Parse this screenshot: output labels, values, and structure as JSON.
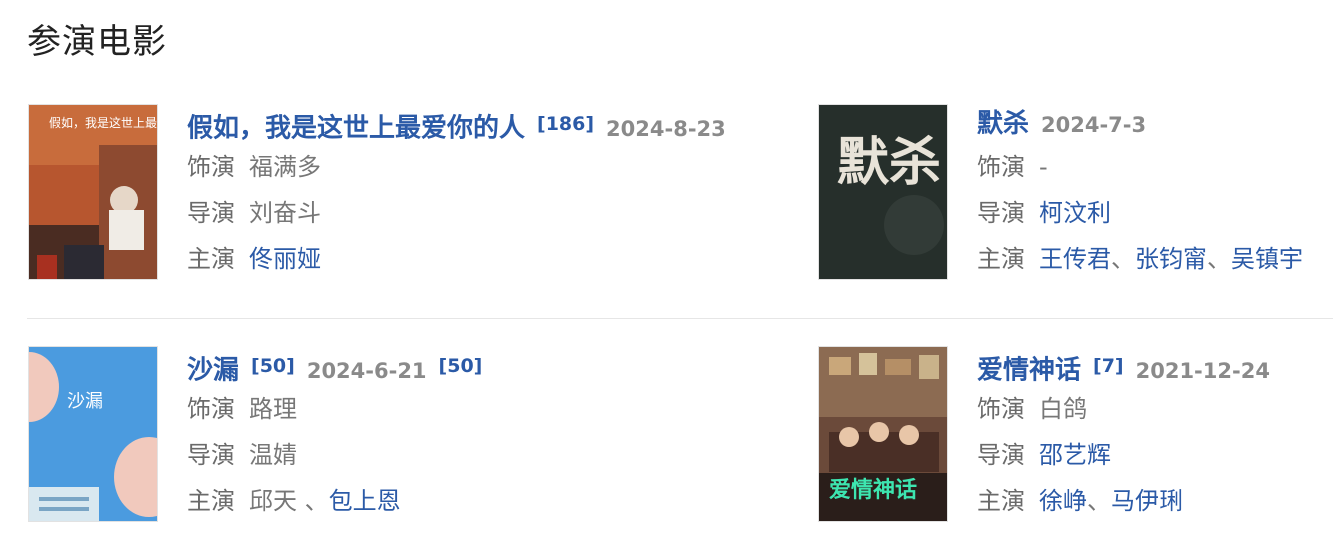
{
  "section": {
    "title": "参演电影"
  },
  "movies": [
    {
      "title": "假如，我是这世上最爱你的人",
      "ref": "[186]",
      "date": "2024-8-23",
      "extra_ref": "",
      "poster_icon": "poster-image",
      "poster_text": "假如，我是这世上最爱你的人",
      "role_label": "饰演",
      "role": "福满多",
      "director_label": "导演",
      "director": "刘奋斗",
      "cast_label": "主演",
      "cast": [
        "佟丽娅"
      ]
    },
    {
      "title": "默杀",
      "ref": "",
      "date": "2024-7-3",
      "extra_ref": "",
      "poster_icon": "poster-image",
      "poster_text": "默杀",
      "role_label": "饰演",
      "role": "-",
      "director_label": "导演",
      "director": "柯汶利",
      "cast_label": "主演",
      "cast": [
        "王传君",
        "张钧甯",
        "吴镇宇"
      ]
    },
    {
      "title": "沙漏",
      "ref": "[50]",
      "date": "2024-6-21",
      "extra_ref": "[50]",
      "poster_icon": "poster-image",
      "poster_text": "沙漏",
      "role_label": "饰演",
      "role": "路理",
      "director_label": "导演",
      "director": "温婧",
      "cast_label": "主演",
      "cast_plain": "邱天 、",
      "cast": [
        "包上恩"
      ]
    },
    {
      "title": "爱情神话",
      "ref": "[7]",
      "date": "2021-12-24",
      "extra_ref": "",
      "poster_icon": "poster-image",
      "poster_text": "爱情神话",
      "role_label": "饰演",
      "role": "白鸽",
      "director_label": "导演",
      "director": "邵艺辉",
      "cast_label": "主演",
      "cast": [
        "徐峥",
        "马伊琍"
      ]
    }
  ]
}
